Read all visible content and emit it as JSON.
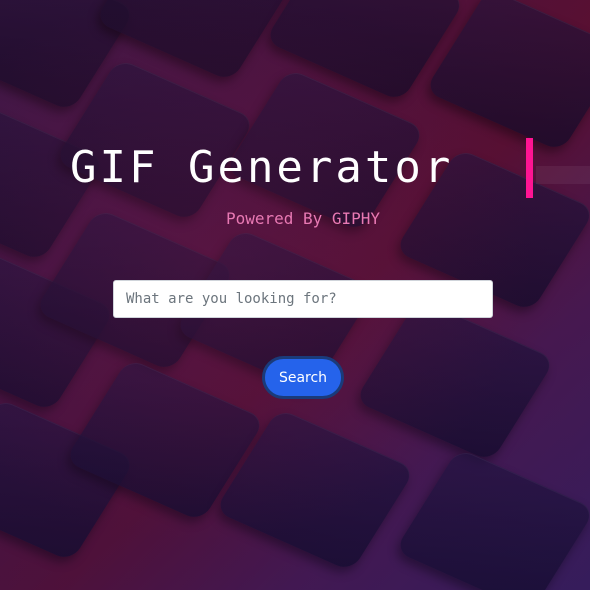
{
  "header": {
    "title": "GIF Generator",
    "subtitle": "Powered By GIPHY"
  },
  "search": {
    "placeholder": "What are you looking for?",
    "value": "",
    "button_label": "Search"
  },
  "colors": {
    "cursor": "#ff1493",
    "subtitle": "#e879b3",
    "button": "#2563eb",
    "button_border": "#1a3b7a"
  }
}
